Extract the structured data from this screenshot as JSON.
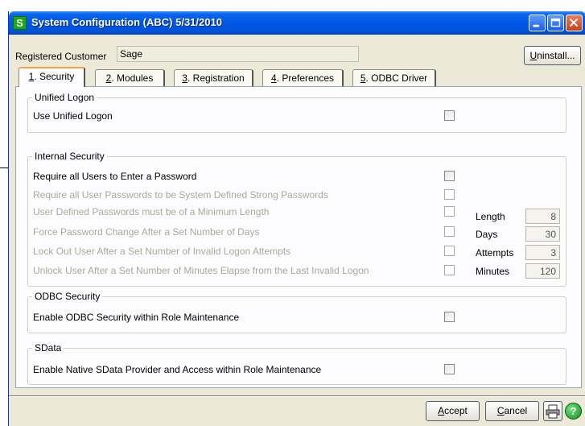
{
  "window": {
    "title": "System Configuration (ABC) 5/31/2010",
    "app_icon_letter": "S"
  },
  "header": {
    "registered_customer_label": "Registered Customer",
    "registered_customer_value": "Sage",
    "uninstall_prefix": "U",
    "uninstall_rest": "ninstall..."
  },
  "tabs": [
    {
      "key": "1",
      "label": ". Security",
      "active": true
    },
    {
      "key": "2",
      "label": ". Modules",
      "active": false
    },
    {
      "key": "3",
      "label": ". Registration",
      "active": false
    },
    {
      "key": "4",
      "label": ". Preferences",
      "active": false
    },
    {
      "key": "5",
      "label": ". ODBC Driver",
      "active": false
    }
  ],
  "unified_logon": {
    "title": "Unified Logon",
    "use_unified_logon": "Use Unified Logon"
  },
  "internal_security": {
    "title": "Internal Security",
    "require_password": "Require all Users to Enter a Password",
    "strong_passwords": "Require all User Passwords to be System Defined Strong Passwords",
    "min_length": "User Defined Passwords must be of a Minimum Length",
    "force_change": "Force Password Change After a Set Number of Days",
    "lock_out": "Lock Out User After a Set Number of Invalid Logon Attempts",
    "unlock": "Unlock User After a Set Number of Minutes Elapse from the Last Invalid Logon",
    "length_label": "Length",
    "length_value": "8",
    "days_label": "Days",
    "days_value": "30",
    "attempts_label": "Attempts",
    "attempts_value": "3",
    "minutes_label": "Minutes",
    "minutes_value": "120"
  },
  "odbc_security": {
    "title": "ODBC Security",
    "enable_odbc": "Enable ODBC Security within Role Maintenance"
  },
  "sdata": {
    "title": "SData",
    "enable_sdata": "Enable Native SData Provider and Access within Role Maintenance"
  },
  "footer": {
    "accept_prefix": "A",
    "accept_rest": "ccept",
    "cancel_prefix": "C",
    "cancel_rest": "ancel",
    "help_glyph": "?"
  }
}
